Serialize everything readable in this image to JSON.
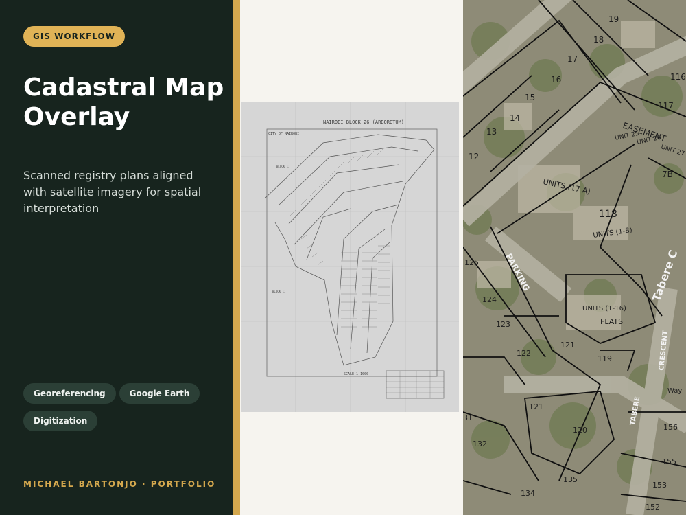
{
  "badge": "GIS WORKFLOW",
  "title": "Cadastral Map Overlay",
  "subtitle": "Scanned registry plans aligned with satellite imagery for spatial interpretation",
  "tags": [
    "Georeferencing",
    "Google Earth",
    "Digitization"
  ],
  "footer": "MICHAEL BARTONJO · PORTFOLIO",
  "colors": {
    "sidebar": "#17241e",
    "accent": "#d4a84e",
    "badge": "#e0b356",
    "tag": "#2b3f36"
  },
  "scan": {
    "heading": "NAIROBI  BLOCK 26 (ARBORETUM)",
    "city": "CITY OF NAIROBI",
    "block_a": "BLOCK 11",
    "block_b": "BLOCK 11",
    "scale": "SCALE  1:1000"
  },
  "overlay": {
    "easement": "EASEMENT",
    "parking": "PARKING",
    "crescent": "CRESCENT",
    "tabere": "TABERE",
    "tabere_c": "Tabere C",
    "units_a": "UNITS (17 A)",
    "units_b": "UNITS (1-8)",
    "units_c": "UNITS (1-16)",
    "flats": "FLATS",
    "unit_25": "UNIT 25",
    "unit_26": "UNIT 26",
    "unit_27": "UNIT 27",
    "way": "Way",
    "parcels": {
      "p19": "19",
      "p18": "18",
      "p17": "17",
      "p16": "16",
      "p15": "15",
      "p14": "14",
      "p13": "13",
      "p12": "12",
      "p116": "116",
      "p117": "117",
      "p118": "118",
      "p125": "125",
      "p124": "124",
      "p123": "123",
      "p122": "122",
      "p119": "119",
      "p121": "121",
      "p120": "120",
      "p131": "31",
      "p132": "132",
      "p134": "134",
      "p135": "135",
      "p156": "156",
      "p155": "155",
      "p153": "153",
      "p152": "152",
      "p7b": "7B",
      "p121b": "121"
    }
  }
}
